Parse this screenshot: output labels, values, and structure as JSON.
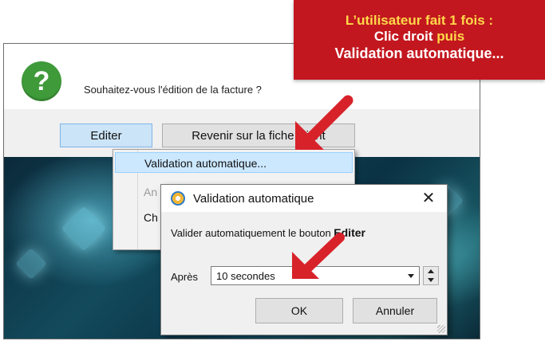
{
  "banner": {
    "line1": "L’utilisateur fait 1 fois :",
    "line2_a": "Clic droit",
    "line2_b": "puis",
    "line3": "Validation automatique..."
  },
  "question_dialog": {
    "message": "Souhaitez-vous l'édition de la facture ?",
    "edit_button": "Editer",
    "back_button": "Revenir sur la fiche client"
  },
  "context_menu": {
    "items": [
      {
        "label": "Validation automatique..."
      },
      {
        "label": "An"
      },
      {
        "label": "Ch"
      }
    ]
  },
  "validation_dialog": {
    "title": "Validation automatique",
    "close": "✕",
    "description_prefix": "Valider automatiquement le bouton",
    "description_button": "Editer",
    "after_label": "Après",
    "after_value": "10 secondes",
    "ok_button": "OK",
    "cancel_button": "Annuler"
  },
  "colors": {
    "banner_bg": "#c3171f",
    "banner_highlight": "#ffd84a",
    "arrow_red": "#d8222a",
    "question_icon": "#3f9a3a"
  },
  "icons": [
    "question-icon",
    "gear-icon",
    "close-icon",
    "chevron-down-icon",
    "spin-up-icon",
    "spin-down-icon"
  ]
}
